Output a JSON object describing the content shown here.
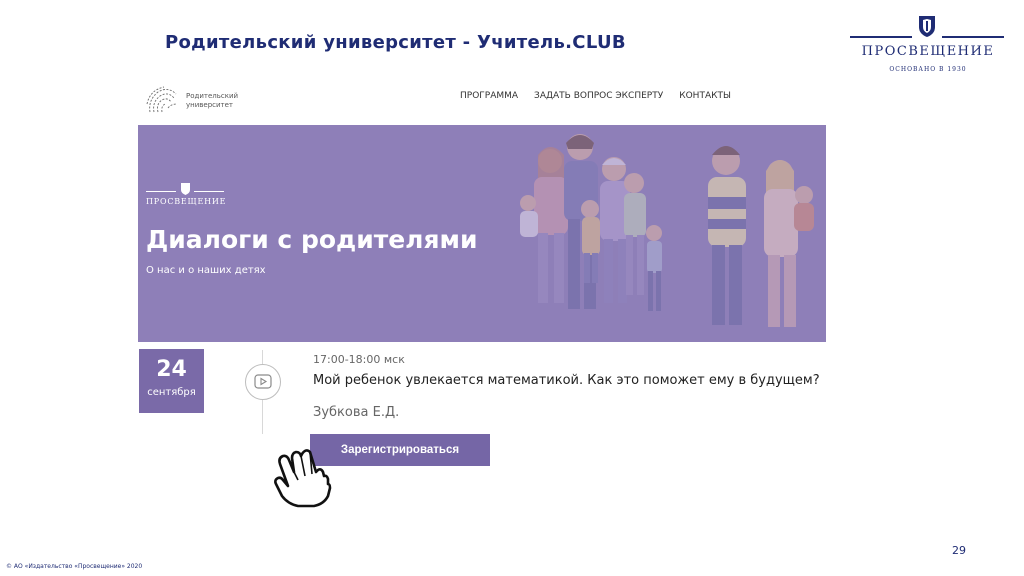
{
  "slide": {
    "title": "Родительский университет - Учитель.CLUB",
    "page_number": "29",
    "copyright": "© АО «Издательство «Просвещение» 2020"
  },
  "brand_logo": {
    "name": "ПРОСВЕЩЕНИЕ",
    "since": "ОСНОВАНО В 1930"
  },
  "site": {
    "logo_text_line1": "Родительский",
    "logo_text_line2": "университет",
    "nav": [
      "ПРОГРАММА",
      "ЗАДАТЬ ВОПРОС ЭКСПЕРТУ",
      "КОНТАКТЫ"
    ]
  },
  "banner": {
    "brand": "ПРОСВЕЩЕНИЕ",
    "title": "Диалоги с родителями",
    "subtitle": "О нас и о наших детях"
  },
  "event": {
    "day": "24",
    "month": "сентября",
    "time": "17:00-18:00 мск",
    "title": "Мой ребенок увлекается математикой. Как это поможет ему в будущем?",
    "author": "Зубкова Е.Д.",
    "register_label": "Зарегистрироваться"
  },
  "colors": {
    "brand_navy": "#1f2c74",
    "banner_purple": "#8e7fb8",
    "accent_purple": "#7566a6"
  },
  "icons": [
    "emblem-icon",
    "fingerprint-logo-icon",
    "play-icon",
    "hand-pointer-icon"
  ]
}
